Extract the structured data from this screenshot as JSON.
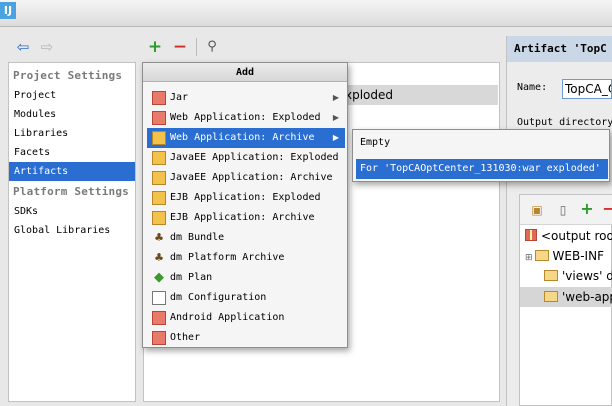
{
  "app": {
    "icon_text": "IJ"
  },
  "toolbar": {
    "back_icon": "back-arrow-icon",
    "forward_icon": "forward-arrow-icon",
    "add_icon": "plus-icon",
    "remove_icon": "minus-icon",
    "search_icon": "magnifier-icon"
  },
  "sidebar": {
    "project_settings_label": "Project Settings",
    "platform_settings_label": "Platform Settings",
    "items": [
      {
        "label": "Project"
      },
      {
        "label": "Modules"
      },
      {
        "label": "Libraries"
      },
      {
        "label": "Facets"
      },
      {
        "label": "Artifacts"
      },
      {
        "label": "SDKs"
      },
      {
        "label": "Global Libraries"
      }
    ]
  },
  "middle": {
    "row_text": "xploded"
  },
  "add_menu": {
    "title": "Add",
    "items": [
      {
        "label": "Jar",
        "icon": "gift-icon"
      },
      {
        "label": "Web Application: Exploded",
        "icon": "gift-icon"
      },
      {
        "label": "Web Application: Archive",
        "icon": "gift-icon"
      },
      {
        "label": "JavaEE Application: Exploded",
        "icon": "gift-icon"
      },
      {
        "label": "JavaEE Application: Archive",
        "icon": "gift-icon"
      },
      {
        "label": "EJB Application: Exploded",
        "icon": "ejb-icon"
      },
      {
        "label": "EJB Application: Archive",
        "icon": "ejb-icon"
      },
      {
        "label": "dm Bundle",
        "icon": "dm-bundle-icon"
      },
      {
        "label": "dm Platform Archive",
        "icon": "dm-platform-icon"
      },
      {
        "label": "dm Plan",
        "icon": "dm-plan-icon"
      },
      {
        "label": "dm Configuration",
        "icon": "document-icon"
      },
      {
        "label": "Android Application",
        "icon": "gift-icon"
      },
      {
        "label": "Other",
        "icon": "gift-icon"
      }
    ]
  },
  "submenu": {
    "items": [
      {
        "label": "Empty"
      },
      {
        "label": "For 'TopCAOptCenter_131030:war exploded'"
      }
    ]
  },
  "artifact_panel": {
    "header": "Artifact 'TopC",
    "name_label": "Name:",
    "name_value": "TopCA_O",
    "output_dir_label": "Output directory",
    "tree": [
      {
        "label": "<output roo"
      },
      {
        "label": "WEB-INF"
      },
      {
        "label": "'views' d"
      },
      {
        "label": "'web-app"
      }
    ]
  },
  "colors": {
    "selection": "#2b6ed2",
    "accent_green": "#2e9b2e",
    "accent_red": "#d12e2e"
  }
}
